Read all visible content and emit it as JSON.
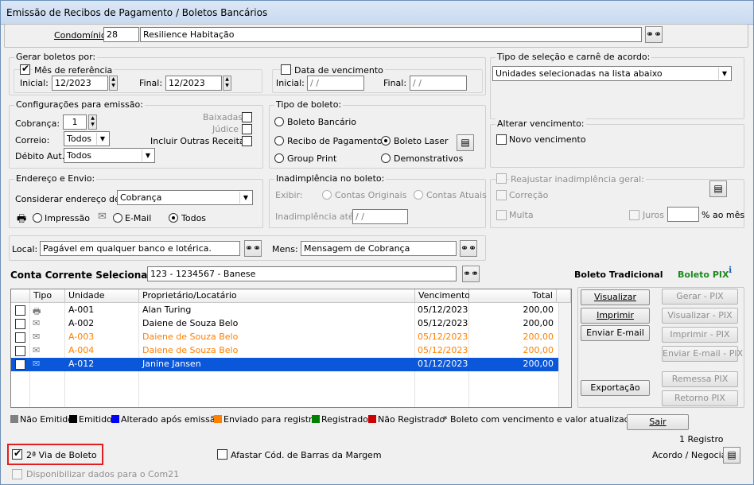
{
  "window": {
    "title": "Emissão de Recibos de Pagamento / Boletos Bancários"
  },
  "condominio": {
    "label": "Condomínio:",
    "code": "28",
    "name": "Resilience Habitação"
  },
  "gerar": {
    "legend": "Gerar boletos por:",
    "mes_ref_label": "Mês de referência",
    "inicial_label": "Inicial:",
    "inicial": "12/2023",
    "final_label": "Final:",
    "final": "12/2023",
    "data_venc_label": "Data de vencimento",
    "inicial2": "/ /",
    "final2": "/ /"
  },
  "tipo_sel": {
    "legend": "Tipo de seleção e carnê de acordo:",
    "value": "Unidades selecionadas na lista abaixo"
  },
  "config": {
    "legend": "Configurações para emissão:",
    "cobranca_label": "Cobrança:",
    "cobranca": "1",
    "correio_label": "Correio:",
    "correio": "Todos",
    "debito_label": "Débito Aut.:",
    "debito": "Todos",
    "baixadas": "Baixadas",
    "judice": "Júdice",
    "incluir": "Incluir Outras Receitas"
  },
  "tipo_boleto": {
    "legend": "Tipo de boleto:",
    "bancario": "Boleto Bancário",
    "recibo": "Recibo de Pagamento",
    "laser": "Boleto Laser",
    "group": "Group Print",
    "demonstrativos": "Demonstrativos"
  },
  "alterar": {
    "legend": "Alterar vencimento:",
    "novo": "Novo vencimento"
  },
  "endereco": {
    "legend": "Endereço e Envio:",
    "considerar_label": "Considerar endereço de:",
    "considerar": "Cobrança",
    "impressao": "Impressão",
    "email": "E-Mail",
    "todos": "Todos"
  },
  "inad": {
    "legend": "Inadimplência no boleto:",
    "exibir": "Exibir:",
    "originais": "Contas Originais",
    "atuais": "Contas Atuais",
    "ate_label": "Inadimplência até:",
    "ate": "/ /"
  },
  "reaj": {
    "reajustar": "Reajustar inadimplência geral:",
    "correcao": "Correção",
    "multa": "Multa",
    "juros": "Juros",
    "ao_mes": "% ao mês"
  },
  "local": {
    "label": "Local:",
    "value": "Pagável em qualquer banco e lotérica.",
    "mens_label": "Mens:",
    "mens": "Mensagem de Cobrança"
  },
  "conta": {
    "label": "Conta Corrente Selecionada:",
    "value": "123 - 1234567 - Banese"
  },
  "boleto_tradicional": "Boleto Tradicional",
  "boleto_pix": "Boleto PIX",
  "table": {
    "headers": [
      "Tipo",
      "Unidade",
      "Proprietário/Locatário",
      "Vencimento",
      "Total"
    ],
    "rows": [
      {
        "tipo": "printer-icon",
        "unidade": "A-001",
        "nome": "Alan Turing",
        "venc": "05/12/2023",
        "total": "200,00",
        "checked": false,
        "status": "normal"
      },
      {
        "tipo": "envelope-icon",
        "unidade": "A-002",
        "nome": "Daiene de Souza Belo",
        "venc": "05/12/2023",
        "total": "200,00",
        "checked": false,
        "status": "normal"
      },
      {
        "tipo": "envelope-icon",
        "unidade": "A-003",
        "nome": "Daiene de Souza Belo",
        "venc": "05/12/2023",
        "total": "200,00",
        "checked": false,
        "status": "orange"
      },
      {
        "tipo": "envelope-icon",
        "unidade": "A-004",
        "nome": "Daiene de Souza Belo",
        "venc": "05/12/2023",
        "total": "200,00",
        "checked": false,
        "status": "orange"
      },
      {
        "tipo": "envelope-icon",
        "unidade": "A-012",
        "nome": "Janine Jansen",
        "venc": "01/12/2023",
        "total": "200,00",
        "checked": true,
        "status": "selected"
      }
    ]
  },
  "buttons": {
    "visualizar": "Visualizar",
    "imprimir": "Imprimir",
    "enviar": "Enviar E-mail",
    "exportacao": "Exportação",
    "gerar_pix": "Gerar - PIX",
    "visualizar_pix": "Visualizar - PIX",
    "imprimir_pix": "Imprimir - PIX",
    "enviar_pix": "Enviar E-mail - PIX",
    "remessa": "Remessa PIX",
    "retorno": "Retorno PIX",
    "sair": "Sair"
  },
  "legend": {
    "items": [
      {
        "label": "Não Emitido",
        "color": "#808080"
      },
      {
        "label": "Emitido",
        "color": "#000000"
      },
      {
        "label": "Alterado após emissão",
        "color": "#0000ff"
      },
      {
        "label": "Enviado para registro",
        "color": "#ff7f00"
      },
      {
        "label": "Registrado",
        "color": "#008000"
      },
      {
        "label": "Não Registrado",
        "color": "#cc0000"
      }
    ],
    "note": "* Boleto com vencimento e valor atualizados."
  },
  "registros": "1 Registro",
  "segunda_via": "2ª Via de Boleto",
  "afastar": "Afastar Cód. de Barras da Margem",
  "acordo": "Acordo / Negociar",
  "disponibilizar": "Disponibilizar dados para o Com21"
}
